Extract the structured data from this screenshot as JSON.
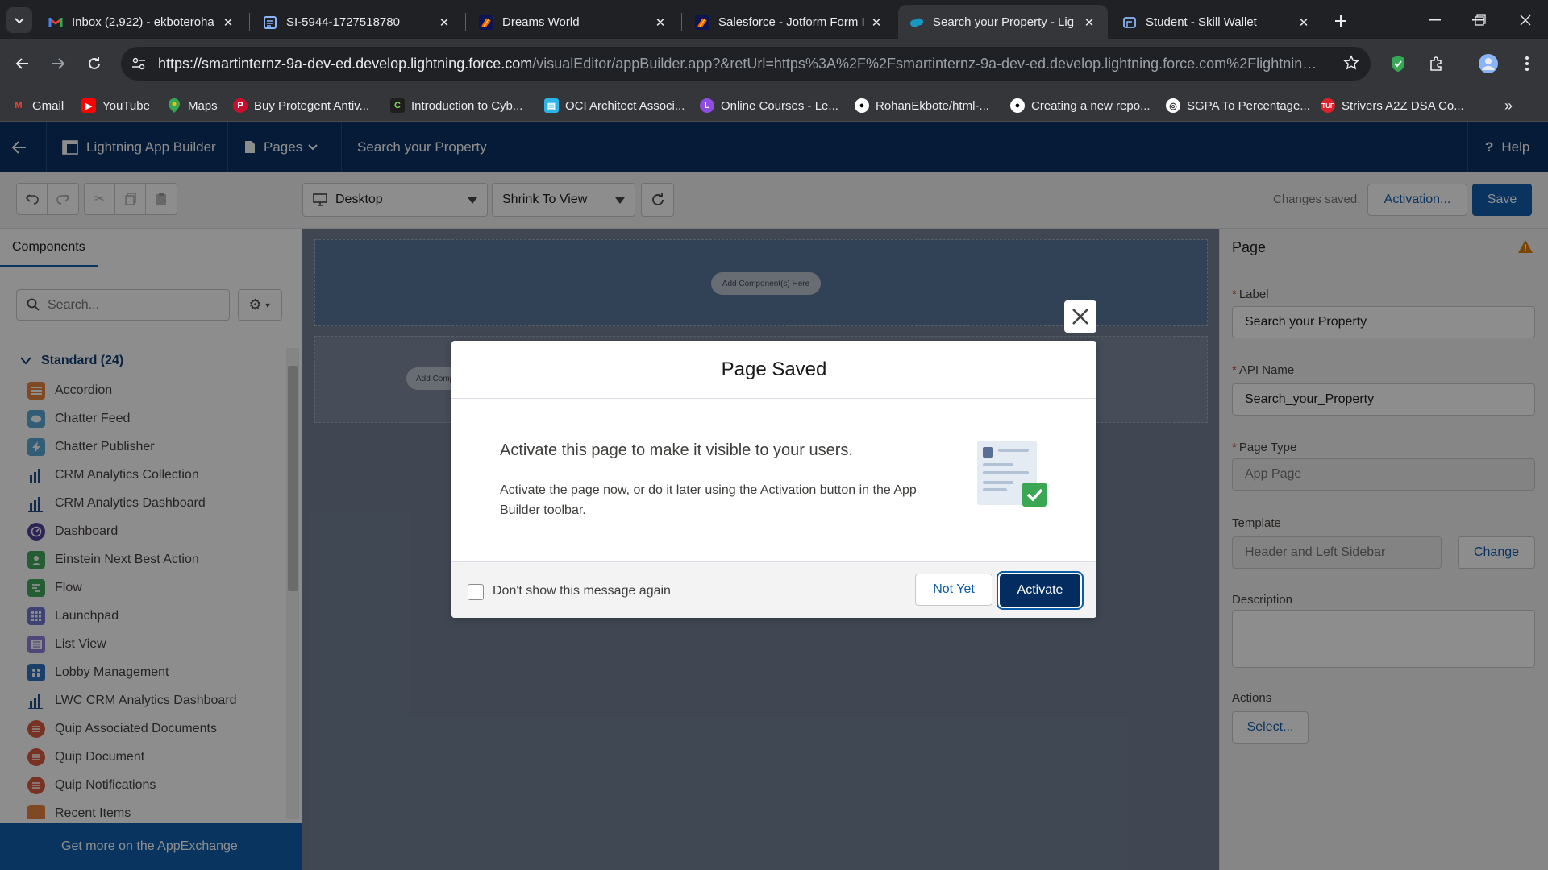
{
  "browser": {
    "tabs": [
      {
        "title": "Inbox (2,922) - ekboteroha",
        "icon": "gmail-icon"
      },
      {
        "title": "SI-5944-1727518780",
        "icon": "document-icon"
      },
      {
        "title": "Dreams World",
        "icon": "jotform-icon"
      },
      {
        "title": "Salesforce - Jotform Form I",
        "icon": "jotform-icon"
      },
      {
        "title": "Search your Property - Lig",
        "icon": "salesforce-cloud-icon"
      },
      {
        "title": "Student - Skill Wallet",
        "icon": "wallet-icon"
      }
    ],
    "url_host": "https://smartinternz-9a-dev-ed.develop.lightning.force.com",
    "url_path": "/visualEditor/appBuilder.app?&retUrl=https%3A%2F%2Fsmartinternz-9a-dev-ed.develop.lightning.force.com%2Flightning%2Fs...",
    "bookmarks": [
      "Gmail",
      "YouTube",
      "Maps",
      "Buy Protegent Antiv...",
      "Introduction to Cyb...",
      "OCI Architect Associ...",
      "Online Courses - Le...",
      "RohanEkbote/html-...",
      "Creating a new repo...",
      "SGPA To Percentage...",
      "Strivers A2Z DSA Co..."
    ]
  },
  "app": {
    "app_name": "Lightning App Builder",
    "pages_label": "Pages",
    "page_title": "Search your Property",
    "help_label": "Help",
    "device": "Desktop",
    "zoom": "Shrink To View",
    "status": "Changes saved.",
    "activation_label": "Activation...",
    "save_label": "Save",
    "brand_color": "#0b5cab",
    "header_color": "#032d60"
  },
  "components_panel": {
    "tab_label": "Components",
    "search_placeholder": "Search...",
    "section_title": "Standard (24)",
    "items": [
      {
        "label": "Accordion",
        "color": "#e3813b"
      },
      {
        "label": "Chatter Feed",
        "color": "#54a7d6"
      },
      {
        "label": "Chatter Publisher",
        "color": "#54a7d6"
      },
      {
        "label": "CRM Analytics Collection",
        "color": "#1b4a8a"
      },
      {
        "label": "CRM Analytics Dashboard",
        "color": "#1b4a8a"
      },
      {
        "label": "Dashboard",
        "color": "#4d3b9c"
      },
      {
        "label": "Einstein Next Best Action",
        "color": "#3ba755"
      },
      {
        "label": "Flow",
        "color": "#3ba755"
      },
      {
        "label": "Launchpad",
        "color": "#6b77d1"
      },
      {
        "label": "List View",
        "color": "#8a7ed6"
      },
      {
        "label": "Lobby Management",
        "color": "#2a6fc1"
      },
      {
        "label": "LWC CRM Analytics Dashboard",
        "color": "#1b4a8a"
      },
      {
        "label": "Quip Associated Documents",
        "color": "#d7553a"
      },
      {
        "label": "Quip Document",
        "color": "#d7553a"
      },
      {
        "label": "Quip Notifications",
        "color": "#d7553a"
      },
      {
        "label": "Recent Items",
        "color": "#e3813b"
      }
    ],
    "appexchange_label": "Get more on the AppExchange"
  },
  "canvas": {
    "add_component_label": "Add Component(s) Here",
    "add_component_partial": "Add Comp"
  },
  "properties": {
    "header": "Page",
    "label_field": "Label",
    "label_value": "Search your Property",
    "api_field": "API Name",
    "api_value": "Search_your_Property",
    "type_field": "Page Type",
    "type_value": "App Page",
    "template_field": "Template",
    "template_value": "Header and Left Sidebar",
    "change_label": "Change",
    "description_field": "Description",
    "actions_field": "Actions",
    "select_label": "Select..."
  },
  "modal": {
    "title": "Page Saved",
    "lead": "Activate this page to make it visible to your users.",
    "text": "Activate the page now, or do it later using the Activation button in the App Builder toolbar.",
    "checkbox_label": "Don't show this message again",
    "not_yet_label": "Not Yet",
    "activate_label": "Activate"
  }
}
